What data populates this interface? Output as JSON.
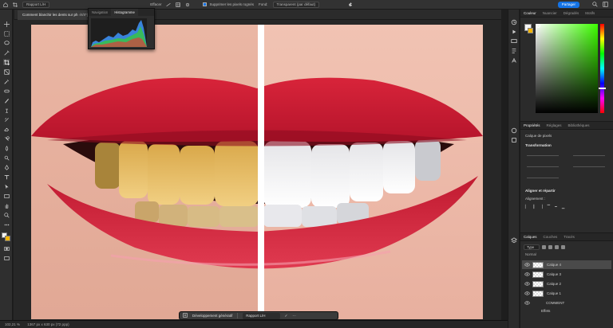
{
  "options_bar": {
    "tool_label": "Rapport L/H",
    "ratio_suffix": "ét/#1 ▾",
    "clear_label": "Effacer",
    "straighten_label": "Redresser",
    "delete_pixels_label": "Supprimer les pixels rognés",
    "fill_label": "Fond:",
    "fill_value": "Transparent (par défaut)",
    "share_label": "Partager"
  },
  "document_tab": {
    "title": "Comment blanchir les dents sur ph",
    "suffix": "ét/8*)"
  },
  "histogram_panel": {
    "tabs": [
      "Navigation",
      "Histogramme"
    ],
    "active_tab": "Histogramme"
  },
  "context_bar": {
    "generate_label": "Développement génératif",
    "ratio_label": "Rapport L/H",
    "more_label": "···"
  },
  "status_bar": {
    "zoom": "102,21 %",
    "doc_size": "1367 px x 630 px (72 ppp)"
  },
  "color_panel": {
    "tabs": [
      "Couleur",
      "Nuancier",
      "Dégradés",
      "Motifs"
    ],
    "active_tab": "Couleur",
    "foreground": "#f5f5f5",
    "background": "#f2b400"
  },
  "properties_panel": {
    "tabs": [
      "Propriétés",
      "Réglages",
      "Bibliothèques"
    ],
    "active_tab": "Propriétés",
    "layer_type": "Calque de pixels",
    "transform_heading": "Transformation",
    "align_heading": "Aligner et répartir",
    "align_label": "Alignement :"
  },
  "layers_panel": {
    "tabs": [
      "Calques",
      "Couches",
      "Tracés"
    ],
    "active_tab": "Calques",
    "filter_label": "Type",
    "blend_label": "Normal",
    "layers": [
      {
        "name": "Calque 4",
        "selected": true
      },
      {
        "name": "Calque 3",
        "selected": false
      },
      {
        "name": "Calque 2",
        "selected": false
      },
      {
        "name": "Calque 1",
        "selected": false
      },
      {
        "name": "COMMENT",
        "selected": false
      },
      {
        "name": "Effets",
        "selected": false
      }
    ]
  }
}
